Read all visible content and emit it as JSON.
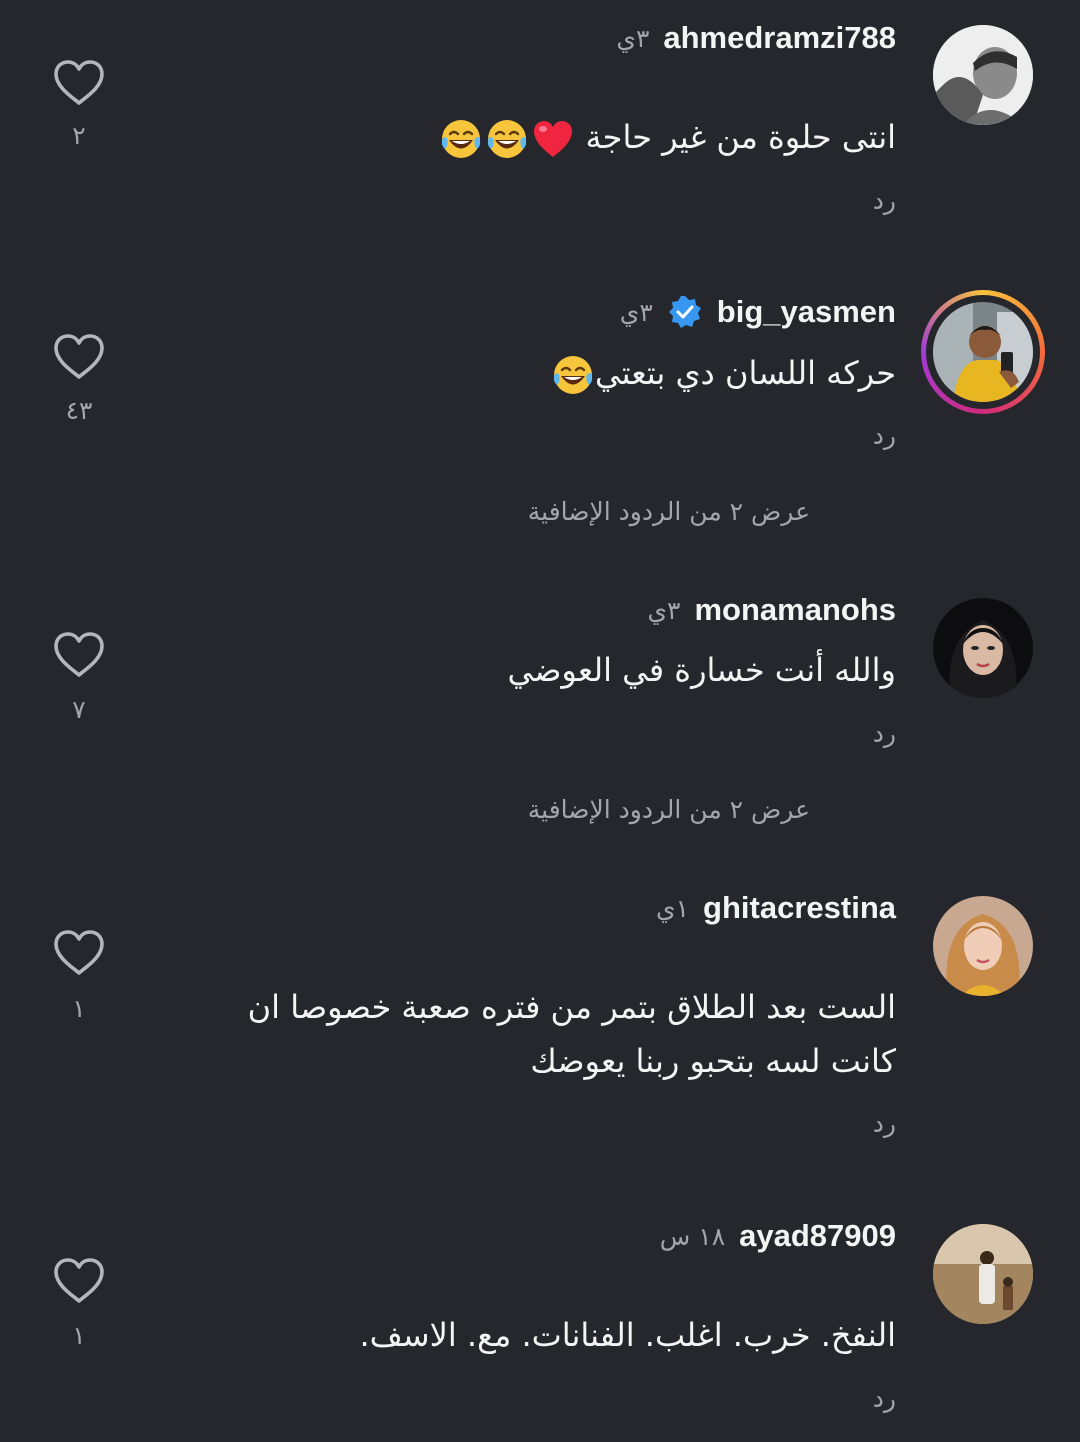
{
  "comments": [
    {
      "username": "ahmedramzi788",
      "time": "٣ي",
      "text": "انتى حلوة من غير حاجة",
      "reply_label": "رد",
      "like_count": "٢"
    },
    {
      "username": "big_yasmen",
      "time": "٣ي",
      "text": "حركه اللسان دي بتعتي",
      "reply_label": "رد",
      "like_count": "٤٣",
      "view_replies": "عرض ٢ من الردود الإضافية"
    },
    {
      "username": "monamanohs",
      "time": "٣ي",
      "text": "والله أنت خسارة في العوضي",
      "reply_label": "رد",
      "like_count": "٧",
      "view_replies": "عرض ٢ من الردود الإضافية"
    },
    {
      "username": "ghitacrestina",
      "time": "١ي",
      "text_line1": "الست بعد الطلاق بتمر من فتره صعبة خصوصا ان",
      "text_line2": "كانت لسه بتحبو ربنا يعوضك",
      "reply_label": "رد",
      "like_count": "١"
    },
    {
      "username": "ayad87909",
      "time": "١٨ س",
      "text": "النفخ.  خرب.  اغلب.  الفنانات.  مع. الاسف.",
      "reply_label": "رد",
      "like_count": "١"
    }
  ],
  "colors": {
    "background": "#25272c",
    "primary_text": "#f4f4f4",
    "secondary_text": "#a4a6ab",
    "verified_badge": "#3897f0",
    "heart_emoji": "#f0253f",
    "laugh_emoji": "#f7c53b"
  },
  "icons": {
    "like": "heart-outline-icon",
    "verified": "verified-badge-icon",
    "emoji_heart": "red-heart-emoji",
    "emoji_laugh": "tears-of-joy-emoji"
  }
}
